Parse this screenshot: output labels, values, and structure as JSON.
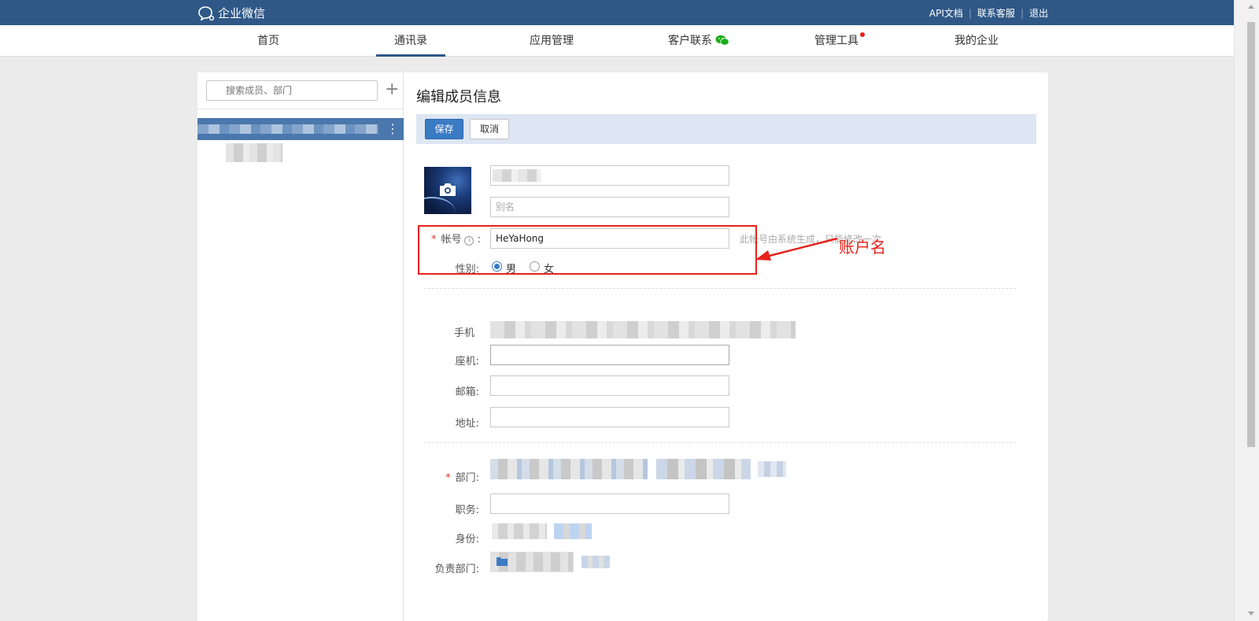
{
  "topbar": {
    "brand": "企业微信",
    "links": [
      "API文档",
      "联系客服",
      "退出"
    ],
    "bg_color": "#2f5887"
  },
  "nav": {
    "items": [
      "首页",
      "通讯录",
      "应用管理",
      "客户联系",
      "管理工具",
      "我的企业"
    ],
    "active": "通讯录"
  },
  "sidebar": {
    "search_placeholder": "搜索成员、部门"
  },
  "editor": {
    "title": "编辑成员信息",
    "save_label": "保存",
    "cancel_label": "取消",
    "alias_placeholder": "别名",
    "account_label": "帐号",
    "account_value": "HeYaHong",
    "account_hint": "此帐号由系统生成，只能修改一次",
    "gender_label": "性别:",
    "gender_options": [
      "男",
      "女"
    ],
    "gender_selected": "男",
    "mobile_label": "手机",
    "landline_label": "座机:",
    "email_label": "邮箱:",
    "address_label": "地址:",
    "dept_label": "部门:",
    "position_label": "职务:",
    "identity_label": "身份:",
    "managed_dept_label": "负责部门:"
  },
  "annotation": {
    "text": "账户名",
    "color": "#e8221a"
  }
}
